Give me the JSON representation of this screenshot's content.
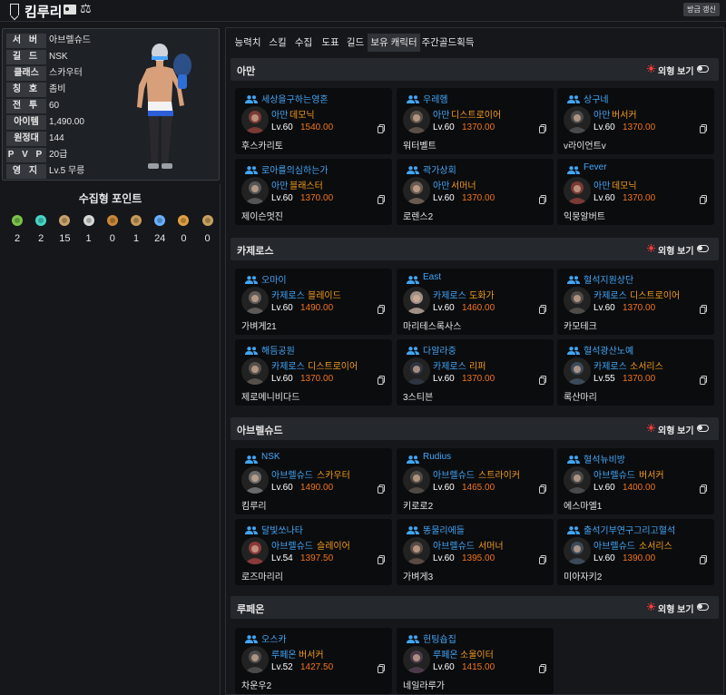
{
  "header": {
    "name": "킴루리",
    "refresh_label": "방금 갱신"
  },
  "profile": {
    "stats": [
      {
        "label": "서 버",
        "value": "아브렐슈드"
      },
      {
        "label": "길 드",
        "value": "NSK"
      },
      {
        "label": "클래스",
        "value": "스카우터"
      },
      {
        "label": "칭 호",
        "value": "좀비"
      },
      {
        "label": "전 투",
        "value": "60"
      },
      {
        "label": "아이템",
        "value": "1,490.00"
      },
      {
        "label": "원정대",
        "value": "144"
      },
      {
        "label": "P V P",
        "value": "20급"
      },
      {
        "label": "영 지",
        "value": "Lv.5 무릉"
      }
    ]
  },
  "collectibles": {
    "title": "수집형 포인트",
    "items": [
      {
        "icon": "mokoko-seed-icon",
        "count": "2"
      },
      {
        "icon": "island-heart-icon",
        "count": "2"
      },
      {
        "icon": "great-art-icon",
        "count": "15"
      },
      {
        "icon": "giant-heart-icon",
        "count": "1"
      },
      {
        "icon": "ignea-token-icon",
        "count": "0"
      },
      {
        "icon": "voyage-adventure-icon",
        "count": "1"
      },
      {
        "icon": "world-tree-leaf-icon",
        "count": "24"
      },
      {
        "icon": "orpheus-star-icon",
        "count": "0"
      },
      {
        "icon": "omnium-star-icon",
        "count": "0"
      }
    ]
  },
  "tabs": [
    "능력치",
    "스킬",
    "수집",
    "도표",
    "길드",
    "보유 캐릭터",
    "주간골드획득"
  ],
  "outer_view_label": "외형 보기",
  "sections": [
    {
      "title": "아만",
      "cards": [
        {
          "name": "세상을구하는영혼",
          "server": "아만",
          "class": "데모닉",
          "level": "Lv.60",
          "ilvl": "1540.00",
          "guild": "후스카리토",
          "portrait": "#7a3a36"
        },
        {
          "name": "우레헴",
          "server": "아만",
          "class": "디스트로이어",
          "level": "Lv.60",
          "ilvl": "1370.00",
          "guild": "워터벨트",
          "portrait": "#5b5048"
        },
        {
          "name": "상구네",
          "server": "아만",
          "class": "버서커",
          "level": "Lv.60",
          "ilvl": "1370.00",
          "guild": "v라이언트v",
          "portrait": "#4a4a4a"
        },
        {
          "name": "로아를의심하는가",
          "server": "아만",
          "class": "블래스터",
          "level": "Lv.60",
          "ilvl": "1370.00",
          "guild": "제이슨멋진",
          "portrait": "#555555"
        },
        {
          "name": "곽가상회",
          "server": "아만",
          "class": "서머너",
          "level": "Lv.60",
          "ilvl": "1370.00",
          "guild": "로렌스2",
          "portrait": "#6a5b50"
        },
        {
          "name": "Fever",
          "server": "아만",
          "class": "데모닉",
          "level": "Lv.60",
          "ilvl": "1370.00",
          "guild": "익뭉알버트",
          "portrait": "#7a3a36"
        }
      ]
    },
    {
      "title": "카제로스",
      "cards": [
        {
          "name": "오마이",
          "server": "카제로스",
          "class": "블레이드",
          "level": "Lv.60",
          "ilvl": "1490.00",
          "guild": "가벼게21",
          "portrait": "#5e5a58"
        },
        {
          "name": "East",
          "server": "카제로스",
          "class": "도화가",
          "level": "Lv.60",
          "ilvl": "1460.00",
          "guild": "마리테스록사스",
          "portrait": "#a09088"
        },
        {
          "name": "혈석지원상단",
          "server": "카제로스",
          "class": "디스트로이어",
          "level": "Lv.60",
          "ilvl": "1370.00",
          "guild": "카모테크",
          "portrait": "#4f4b48"
        },
        {
          "name": "해듬공원",
          "server": "카제로스",
          "class": "디스트로이어",
          "level": "Lv.60",
          "ilvl": "1370.00",
          "guild": "제로메니비다드",
          "portrait": "#55504c"
        },
        {
          "name": "다알라중",
          "server": "카제로스",
          "class": "리퍼",
          "level": "Lv.60",
          "ilvl": "1370.00",
          "guild": "3스티븐",
          "portrait": "#2e3440"
        },
        {
          "name": "혈석광산노예",
          "server": "카제로스",
          "class": "소서리스",
          "level": "Lv.55",
          "ilvl": "1370.00",
          "guild": "록산마리",
          "portrait": "#3c4a5a"
        }
      ]
    },
    {
      "title": "아브렐슈드",
      "cards": [
        {
          "name": "NSK",
          "server": "아브렐슈드",
          "class": "스카우터",
          "level": "Lv.60",
          "ilvl": "1490.00",
          "guild": "킴루리",
          "portrait": "#6a6a6a"
        },
        {
          "name": "Rudius",
          "server": "아브렐슈드",
          "class": "스트라이커",
          "level": "Lv.60",
          "ilvl": "1465.00",
          "guild": "키로로2",
          "portrait": "#504a44"
        },
        {
          "name": "혈석뉴비방",
          "server": "아브렐슈드",
          "class": "버서커",
          "level": "Lv.60",
          "ilvl": "1400.00",
          "guild": "에스마엘1",
          "portrait": "#4a4a4a"
        },
        {
          "name": "달빛쏘나타",
          "server": "아브렐슈드",
          "class": "슬레이어",
          "level": "Lv.54",
          "ilvl": "1397.50",
          "guild": "로즈마리리",
          "portrait": "#8a3a3a"
        },
        {
          "name": "똥물리에들",
          "server": "아브렐슈드",
          "class": "서머너",
          "level": "Lv.60",
          "ilvl": "1395.00",
          "guild": "가벼게3",
          "portrait": "#5a4a44"
        },
        {
          "name": "출석기부연구그리고혈석",
          "server": "아브렐슈드",
          "class": "소서리스",
          "level": "Lv.60",
          "ilvl": "1390.00",
          "guild": "미아자키2",
          "portrait": "#3c4a5a"
        }
      ]
    },
    {
      "title": "루페온",
      "cards": [
        {
          "name": "오스카",
          "server": "루페온",
          "class": "버서커",
          "level": "Lv.52",
          "ilvl": "1427.50",
          "guild": "차운우2",
          "portrait": "#4a4a4a"
        },
        {
          "name": "헌팅숍집",
          "server": "루페온",
          "class": "소울이터",
          "level": "Lv.60",
          "ilvl": "1415.00",
          "guild": "네일라루가",
          "portrait": "#4a3a4a"
        }
      ]
    }
  ]
}
